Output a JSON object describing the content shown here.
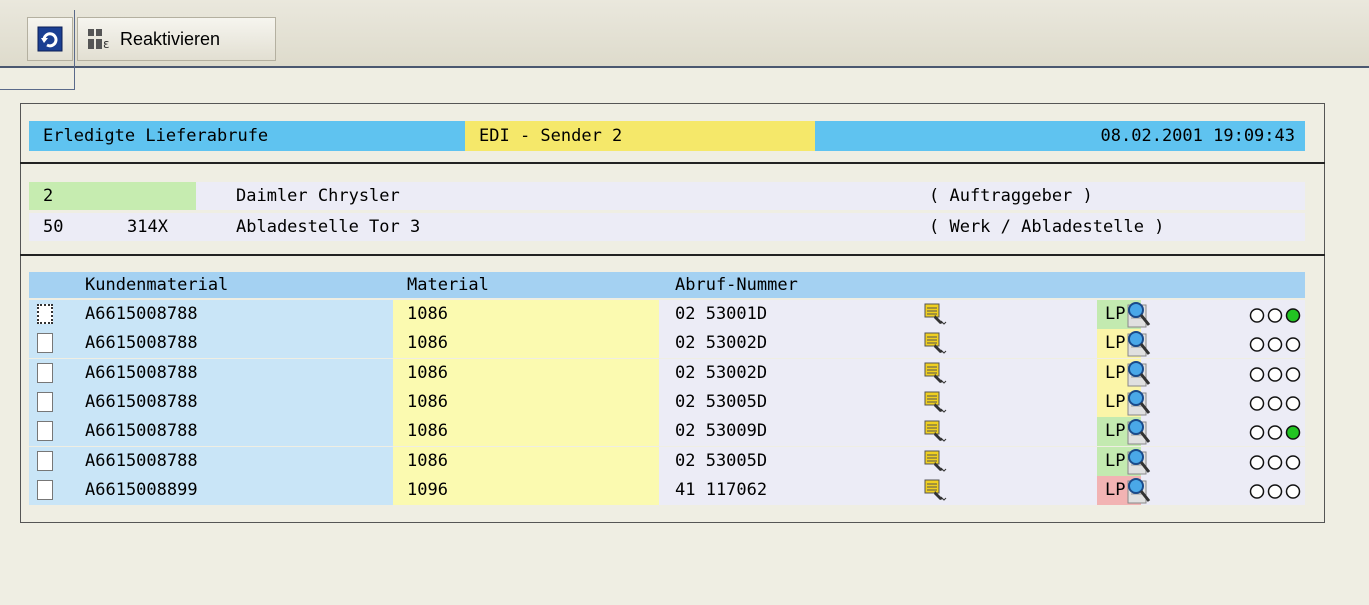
{
  "toolbar": {
    "refresh_icon": "refresh-icon",
    "reactivate_icon": "reactivate-icon",
    "reactivate_label": "Reaktivieren"
  },
  "header": {
    "title": "Erledigte Lieferabrufe",
    "sender": "EDI - Sender  2",
    "datetime": "08.02.2001 19:09:43"
  },
  "info": {
    "customer_no": "2",
    "customer_name": "Daimler Chrysler",
    "customer_role": "( Auftraggeber )",
    "plant": "50",
    "unload_code": "314X",
    "unload_name": "Abladestelle Tor 3",
    "unload_role": "( Werk / Abladestelle )"
  },
  "table": {
    "columns": [
      "Kundenmaterial",
      "Material",
      "Abruf-Nummer"
    ],
    "rows": [
      {
        "kundenmaterial": "A6615008788",
        "material": "1086",
        "abruf": "02 53001D",
        "lp": "LP",
        "lp_status": "green",
        "light": "green"
      },
      {
        "kundenmaterial": "A6615008788",
        "material": "1086",
        "abruf": "02 53002D",
        "lp": "LP",
        "lp_status": "yellow",
        "light": "none"
      },
      {
        "kundenmaterial": "A6615008788",
        "material": "1086",
        "abruf": "02 53002D",
        "lp": "LP",
        "lp_status": "yellow",
        "light": "none"
      },
      {
        "kundenmaterial": "A6615008788",
        "material": "1086",
        "abruf": "02 53005D",
        "lp": "LP",
        "lp_status": "yellow",
        "light": "none"
      },
      {
        "kundenmaterial": "A6615008788",
        "material": "1086",
        "abruf": "02 53009D",
        "lp": "LP",
        "lp_status": "green",
        "light": "green"
      },
      {
        "kundenmaterial": "A6615008788",
        "material": "1086",
        "abruf": "02 53005D",
        "lp": "LP",
        "lp_status": "green",
        "light": "none"
      },
      {
        "kundenmaterial": "A6615008899",
        "material": "1096",
        "abruf": "41 117062",
        "lp": "LP",
        "lp_status": "red",
        "light": "none"
      }
    ]
  },
  "colors": {
    "header_blue": "#5fc3f0",
    "header_yellow": "#f5e86a",
    "column_head": "#a4d1f2",
    "lp_green": "#c3eab0",
    "lp_yellow": "#fbf5a8",
    "lp_red": "#f2b3b3",
    "light_green": "#22c422"
  }
}
